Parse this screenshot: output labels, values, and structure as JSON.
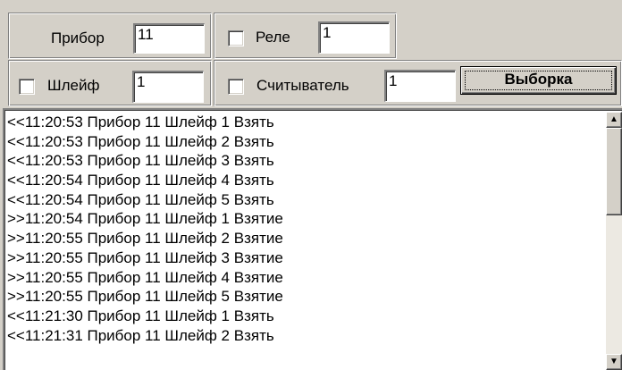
{
  "filters": {
    "device_label": "Прибор",
    "device_value": "11",
    "relay_label": "Реле",
    "relay_value": "1",
    "loop_label": "Шлейф",
    "loop_value": "1",
    "reader_label": "Считыватель",
    "reader_value": "1",
    "select_button": "Выборка"
  },
  "log": [
    "<<11:20:53 Прибор 11 Шлейф 1 Взять",
    "<<11:20:53 Прибор 11 Шлейф 2 Взять",
    "<<11:20:53 Прибор 11 Шлейф 3 Взять",
    "<<11:20:54 Прибор 11 Шлейф 4 Взять",
    "<<11:20:54 Прибор 11 Шлейф 5 Взять",
    ">>11:20:54 Прибор 11 Шлейф 1 Взятие",
    ">>11:20:55 Прибор 11 Шлейф 2 Взятие",
    ">>11:20:55 Прибор 11 Шлейф 3 Взятие",
    ">>11:20:55 Прибор 11 Шлейф 4 Взятие",
    ">>11:20:55 Прибор 11 Шлейф 5 Взятие",
    "<<11:21:30 Прибор 11 Шлейф 1 Взять",
    "<<11:21:31 Прибор 11 Шлейф 2 Взять"
  ],
  "icons": {
    "scroll_up": "up-arrow-icon",
    "scroll_down": "down-arrow-icon"
  }
}
